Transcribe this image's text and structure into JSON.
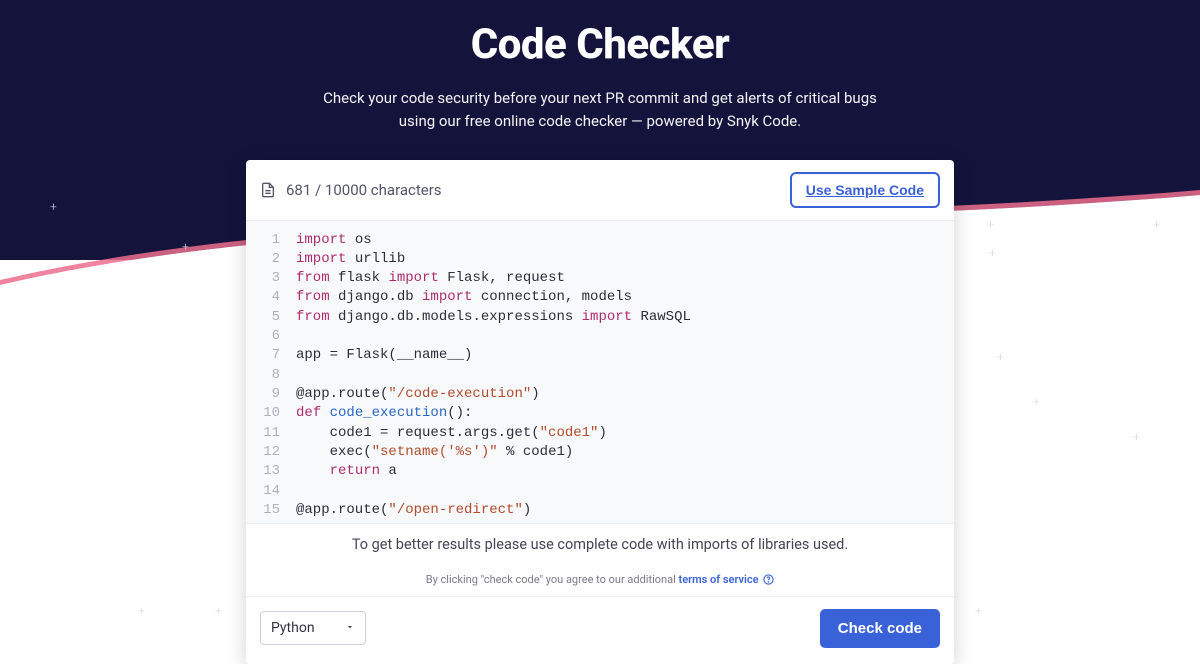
{
  "header": {
    "title": "Code Checker",
    "subtitle_line1": "Check your code security before your next PR commit and get alerts of critical bugs",
    "subtitle_line2": "using our free online code checker — powered by Snyk Code."
  },
  "editor": {
    "char_count": "681 / 10000 characters",
    "sample_button": "Use Sample Code",
    "lines": [
      {
        "n": "1",
        "tokens": [
          {
            "t": "import ",
            "c": "kw"
          },
          {
            "t": "os",
            "c": "mod"
          }
        ]
      },
      {
        "n": "2",
        "tokens": [
          {
            "t": "import ",
            "c": "kw"
          },
          {
            "t": "urllib",
            "c": "mod"
          }
        ]
      },
      {
        "n": "3",
        "tokens": [
          {
            "t": "from ",
            "c": "kw"
          },
          {
            "t": "flask ",
            "c": "mod"
          },
          {
            "t": "import ",
            "c": "kw"
          },
          {
            "t": "Flask, request",
            "c": "mod"
          }
        ]
      },
      {
        "n": "4",
        "tokens": [
          {
            "t": "from ",
            "c": "kw"
          },
          {
            "t": "django.db ",
            "c": "mod"
          },
          {
            "t": "import ",
            "c": "kw"
          },
          {
            "t": "connection, models",
            "c": "mod"
          }
        ]
      },
      {
        "n": "5",
        "tokens": [
          {
            "t": "from ",
            "c": "kw"
          },
          {
            "t": "django.db.models.expressions ",
            "c": "mod"
          },
          {
            "t": "import ",
            "c": "kw"
          },
          {
            "t": "RawSQL",
            "c": "mod"
          }
        ]
      },
      {
        "n": "6",
        "tokens": [
          {
            "t": "",
            "c": "mod"
          }
        ]
      },
      {
        "n": "7",
        "tokens": [
          {
            "t": "app = Flask(__name__)",
            "c": "mod"
          }
        ]
      },
      {
        "n": "8",
        "tokens": [
          {
            "t": "",
            "c": "mod"
          }
        ]
      },
      {
        "n": "9",
        "tokens": [
          {
            "t": "@app.route(",
            "c": "mod"
          },
          {
            "t": "\"/code-execution\"",
            "c": "str"
          },
          {
            "t": ")",
            "c": "mod"
          }
        ]
      },
      {
        "n": "10",
        "tokens": [
          {
            "t": "def ",
            "c": "kw"
          },
          {
            "t": "code_execution",
            "c": "fn"
          },
          {
            "t": "():",
            "c": "mod"
          }
        ]
      },
      {
        "n": "11",
        "tokens": [
          {
            "t": "    code1 = request.args.get(",
            "c": "mod"
          },
          {
            "t": "\"code1\"",
            "c": "str"
          },
          {
            "t": ")",
            "c": "mod"
          }
        ]
      },
      {
        "n": "12",
        "tokens": [
          {
            "t": "    exec(",
            "c": "mod"
          },
          {
            "t": "\"setname('%s')\"",
            "c": "str"
          },
          {
            "t": " % code1)",
            "c": "mod"
          }
        ]
      },
      {
        "n": "13",
        "tokens": [
          {
            "t": "    ",
            "c": "mod"
          },
          {
            "t": "return ",
            "c": "kw"
          },
          {
            "t": "a",
            "c": "mod"
          }
        ]
      },
      {
        "n": "14",
        "tokens": [
          {
            "t": "",
            "c": "mod"
          }
        ]
      },
      {
        "n": "15",
        "tokens": [
          {
            "t": "@app.route(",
            "c": "mod"
          },
          {
            "t": "\"/open-redirect\"",
            "c": "str"
          },
          {
            "t": ")",
            "c": "mod"
          }
        ]
      }
    ],
    "hint": "To get better results please use complete code with imports of libraries used.",
    "terms_prefix": "By clicking \"check code\" you agree to our additional ",
    "terms_link": "terms of service",
    "language": "Python",
    "check_button": "Check code"
  }
}
